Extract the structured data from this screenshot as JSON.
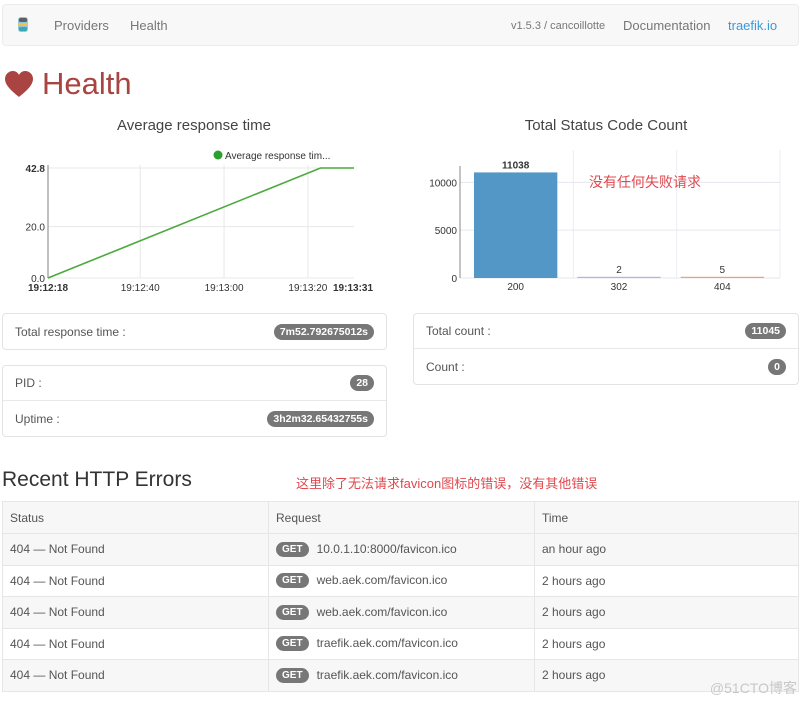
{
  "navbar": {
    "logo": "traefik-logo-icon",
    "links": [
      "Providers",
      "Health"
    ],
    "version": "v1.5.3 / cancoillotte",
    "documentation": "Documentation",
    "site_link": "traefik.io",
    "site_link_color": "#3a9ad9"
  },
  "page": {
    "icon": "heart-icon",
    "title": "Health",
    "title_color": "#a94442"
  },
  "chart_data": [
    {
      "type": "line",
      "title": "Average response time",
      "legend": [
        "Average response tim..."
      ],
      "legend_position": "top-right",
      "series_color": "#4aaa3c",
      "xlabel": "",
      "ylabel": "",
      "x_ticks": [
        "19:12:18",
        "19:12:40",
        "19:13:00",
        "19:13:20",
        "19:13:31"
      ],
      "y_ticks": [
        "0.0",
        "20.0",
        "42.8"
      ],
      "ylim": [
        0,
        42.8
      ],
      "x_seconds_from_start": [
        0,
        65,
        73
      ],
      "series": [
        {
          "name": "Average response time",
          "x": [
            "19:12:18",
            "19:13:23",
            "19:13:31"
          ],
          "values": [
            0,
            42.8,
            42.8
          ]
        }
      ],
      "grid": true
    },
    {
      "type": "bar",
      "title": "Total Status Code Count",
      "categories": [
        "200",
        "302",
        "404"
      ],
      "values": [
        11038,
        2,
        5
      ],
      "colors": [
        "#5397c7",
        "#aab8e0",
        "#f5a25d"
      ],
      "data_labels": [
        "11038",
        "2",
        "5"
      ],
      "y_ticks": [
        "0",
        "5000",
        "10000"
      ],
      "ylim": [
        0,
        11500
      ],
      "xlabel": "",
      "ylabel": "",
      "grid": true
    }
  ],
  "annotations": {
    "chart_note": "没有任何失败请求",
    "errors_note": "这里除了无法请求favicon图标的错误，没有其他错误"
  },
  "stats": {
    "total_response_time_label": "Total response time :",
    "total_response_time": "7m52.792675012s",
    "pid_label": "PID :",
    "pid": "28",
    "uptime_label": "Uptime :",
    "uptime": "3h2m32.65432755s",
    "total_count_label": "Total count :",
    "total_count": "11045",
    "count_label": "Count :",
    "count": "0"
  },
  "errors": {
    "title": "Recent HTTP Errors",
    "columns": [
      "Status",
      "Request",
      "Time"
    ],
    "rows": [
      {
        "status": "404 — Not Found",
        "method": "GET",
        "url": "10.0.1.10:8000/favicon.ico",
        "time": "an hour ago"
      },
      {
        "status": "404 — Not Found",
        "method": "GET",
        "url": "web.aek.com/favicon.ico",
        "time": "2 hours ago"
      },
      {
        "status": "404 — Not Found",
        "method": "GET",
        "url": "web.aek.com/favicon.ico",
        "time": "2 hours ago"
      },
      {
        "status": "404 — Not Found",
        "method": "GET",
        "url": "traefik.aek.com/favicon.ico",
        "time": "2 hours ago"
      },
      {
        "status": "404 — Not Found",
        "method": "GET",
        "url": "traefik.aek.com/favicon.ico",
        "time": "2 hours ago"
      }
    ]
  },
  "watermark": "@51CTO博客"
}
